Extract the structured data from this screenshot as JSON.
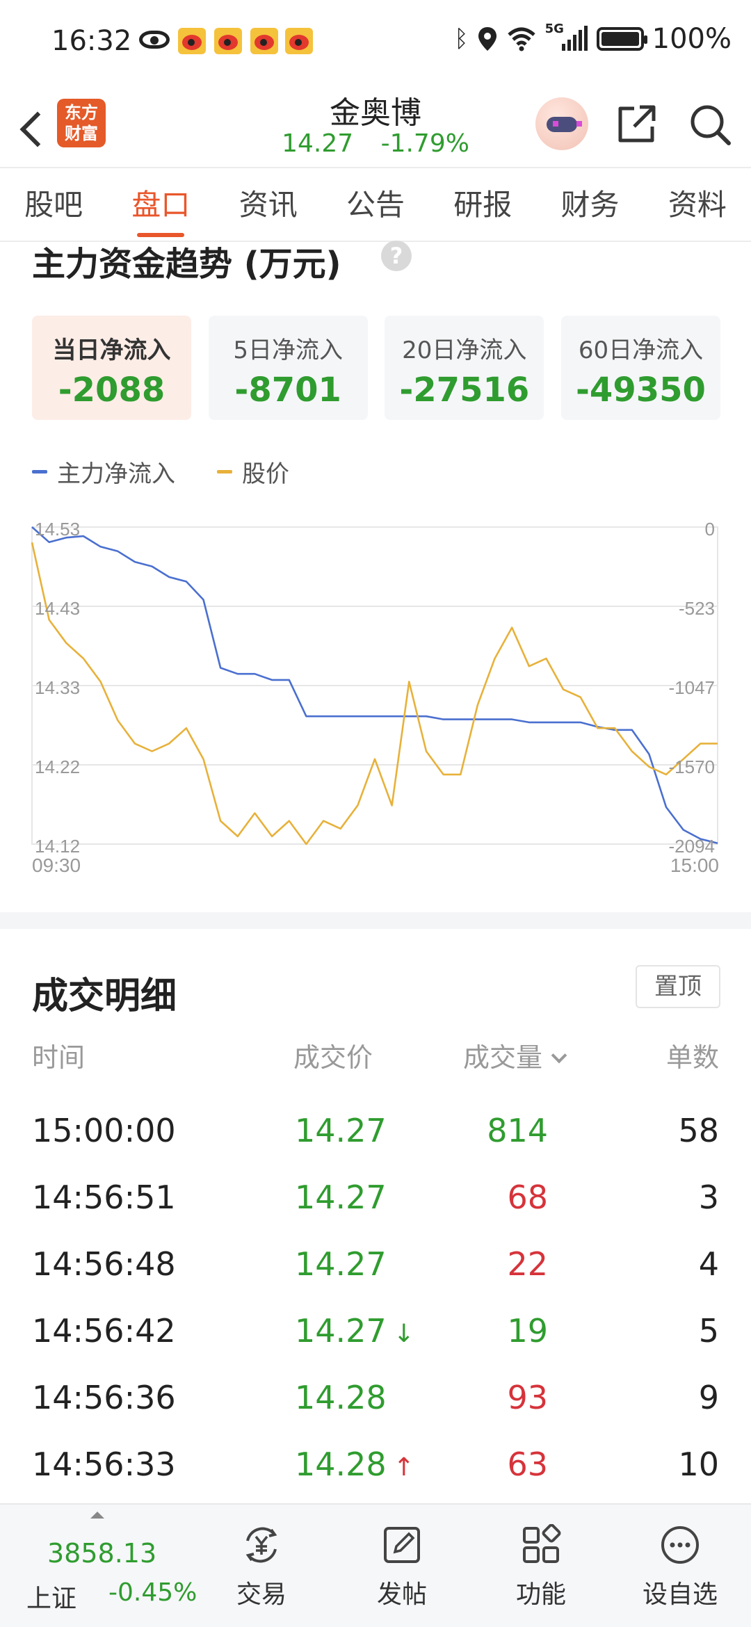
{
  "status_bar": {
    "time": "16:32",
    "network": "5G",
    "battery": "100%"
  },
  "header": {
    "back_icon": "chevron-left-icon",
    "logo_text": [
      "东方",
      "财富"
    ],
    "stock_name": "金奥博",
    "price": "14.27",
    "change_pct": "-1.79%"
  },
  "tabs": [
    {
      "label": "股吧",
      "active": false
    },
    {
      "label": "盘口",
      "active": true
    },
    {
      "label": "资讯",
      "active": false
    },
    {
      "label": "公告",
      "active": false
    },
    {
      "label": "研报",
      "active": false
    },
    {
      "label": "财务",
      "active": false
    },
    {
      "label": "资料",
      "active": false
    }
  ],
  "main_flow": {
    "title": "主力资金趋势 (万元)",
    "help_symbol": "?",
    "cards": [
      {
        "label": "当日净流入",
        "value": "-2088",
        "active": true
      },
      {
        "label": "5日净流入",
        "value": "-8701",
        "active": false
      },
      {
        "label": "20日净流入",
        "value": "-27516",
        "active": false
      },
      {
        "label": "60日净流入",
        "value": "-49350",
        "active": false
      }
    ],
    "legend": [
      {
        "label": "主力净流入",
        "color": "#4a6fcf"
      },
      {
        "label": "股价",
        "color": "#e7b13a"
      }
    ]
  },
  "chart_data": {
    "type": "line",
    "x_start": "09:30",
    "x_end": "15:00",
    "left_axis_label_values": [
      "14.53",
      "14.43",
      "14.33",
      "14.22",
      "14.12"
    ],
    "right_axis_label_values": [
      "0",
      "-523",
      "-1047",
      "-1570",
      "-2094"
    ],
    "price_ylim": [
      14.12,
      14.53
    ],
    "flow_ylim": [
      -2094,
      0
    ],
    "grid": true,
    "series": [
      {
        "name": "主力净流入",
        "axis": "right",
        "color": "#4a6fcf",
        "values": [
          0,
          -100,
          -70,
          -60,
          -130,
          -160,
          -230,
          -260,
          -330,
          -360,
          -480,
          -930,
          -970,
          -970,
          -1010,
          -1010,
          -1250,
          -1250,
          -1250,
          -1250,
          -1250,
          -1250,
          -1250,
          -1250,
          -1270,
          -1270,
          -1270,
          -1270,
          -1270,
          -1290,
          -1290,
          -1290,
          -1290,
          -1320,
          -1340,
          -1340,
          -1500,
          -1850,
          -2000,
          -2060,
          -2088
        ]
      },
      {
        "name": "股价",
        "axis": "left",
        "color": "#e7b13a",
        "values": [
          14.51,
          14.41,
          14.38,
          14.36,
          14.33,
          14.28,
          14.25,
          14.24,
          14.25,
          14.27,
          14.23,
          14.15,
          14.13,
          14.16,
          14.13,
          14.15,
          14.12,
          14.15,
          14.14,
          14.17,
          14.23,
          14.17,
          14.33,
          14.24,
          14.21,
          14.21,
          14.3,
          14.36,
          14.4,
          14.35,
          14.36,
          14.32,
          14.31,
          14.27,
          14.27,
          14.24,
          14.22,
          14.21,
          14.23,
          14.25,
          14.25
        ]
      }
    ]
  },
  "trades": {
    "title": "成交明细",
    "pin_label": "置顶",
    "headers": {
      "time": "时间",
      "price": "成交价",
      "volume": "成交量",
      "count": "单数"
    },
    "rows": [
      {
        "time": "15:00:00",
        "price": "14.27",
        "arrow": "",
        "volume": "814",
        "vol_dir": "dn",
        "count": "58"
      },
      {
        "time": "14:56:51",
        "price": "14.27",
        "arrow": "",
        "volume": "68",
        "vol_dir": "up",
        "count": "3"
      },
      {
        "time": "14:56:48",
        "price": "14.27",
        "arrow": "",
        "volume": "22",
        "vol_dir": "up",
        "count": "4"
      },
      {
        "time": "14:56:42",
        "price": "14.27",
        "arrow": "↓",
        "volume": "19",
        "vol_dir": "dn",
        "count": "5"
      },
      {
        "time": "14:56:36",
        "price": "14.28",
        "arrow": "",
        "volume": "93",
        "vol_dir": "up",
        "count": "9"
      },
      {
        "time": "14:56:33",
        "price": "14.28",
        "arrow": "↑",
        "volume": "63",
        "vol_dir": "up",
        "count": "10"
      }
    ]
  },
  "bottom_nav": {
    "index_value": "3858.13",
    "index_name": "上证",
    "index_change": "-0.45%",
    "items": [
      {
        "label": "交易",
        "icon": "yuan-exchange-icon"
      },
      {
        "label": "发帖",
        "icon": "edit-post-icon"
      },
      {
        "label": "功能",
        "icon": "grid-apps-icon"
      },
      {
        "label": "设自选",
        "icon": "more-circle-icon"
      }
    ]
  }
}
